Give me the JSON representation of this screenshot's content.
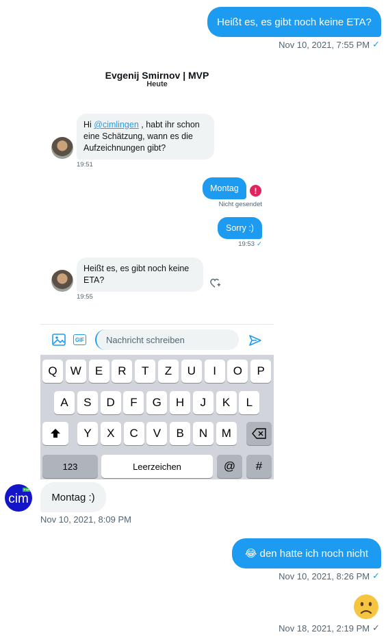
{
  "messages": {
    "m1": {
      "text": "Heißt es, es gibt noch keine ETA?",
      "time": "Nov 10, 2021, 7:55 PM"
    },
    "m2": {
      "text": "Montag :)",
      "time": "Nov 10, 2021, 8:09 PM",
      "avatar_text": "cim",
      "avatar_tag": "lingen"
    },
    "m3": {
      "text": "😂 den hatte ich noch nicht",
      "time": "Nov 10, 2021, 8:26 PM"
    },
    "m4": {
      "emoji": "🙁",
      "time": "Nov 18, 2021, 2:19 PM"
    }
  },
  "screenshot": {
    "header_name": "Evgenij Smirnov | MVP",
    "header_sub": "Heute",
    "msg1_prefix": "Hi ",
    "msg1_mention": "@cimlingen",
    "msg1_rest": " , habt ihr schon eine Schätzung, wann es die Aufzeichnungen gibt?",
    "msg1_time": "19:51",
    "msg2_text": "Montag",
    "msg2_status": "Nicht gesendet",
    "msg3_text": "Sorry :)",
    "msg3_time": "19:53",
    "msg4_text": "Heißt es, es gibt noch keine ETA?",
    "msg4_time": "19:55",
    "compose_placeholder": "Nachricht schreiben",
    "gif_label": "GIF",
    "keyboard": {
      "row1": [
        "Q",
        "W",
        "E",
        "R",
        "T",
        "Z",
        "U",
        "I",
        "O",
        "P"
      ],
      "row2": [
        "A",
        "S",
        "D",
        "F",
        "G",
        "H",
        "J",
        "K",
        "L"
      ],
      "row3": [
        "Y",
        "X",
        "C",
        "V",
        "B",
        "N",
        "M"
      ],
      "numbers": "123",
      "space": "Leerzeichen",
      "at": "@",
      "hash": "#"
    }
  },
  "colors": {
    "accent": "#1d9bf0",
    "bubble_gray": "#eff3f4",
    "meta": "#536471",
    "error": "#e0245e"
  }
}
